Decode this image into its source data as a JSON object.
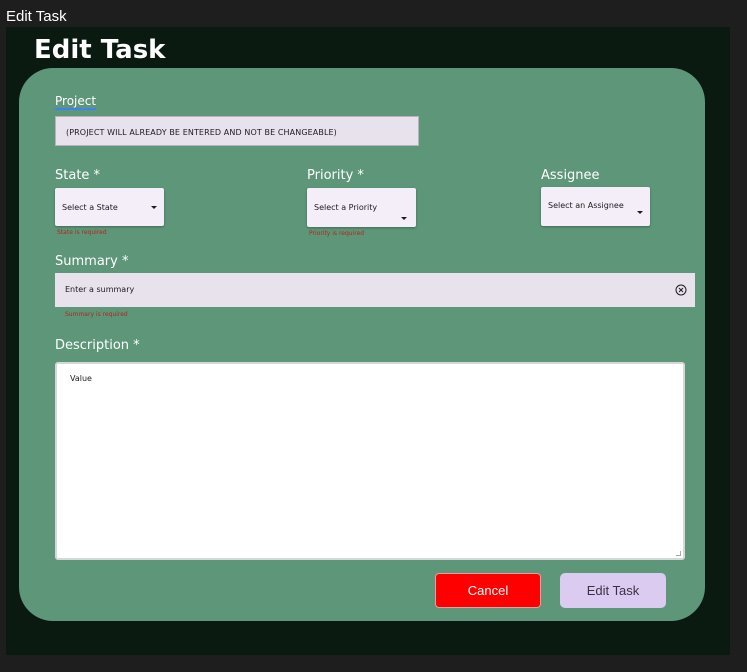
{
  "frame_label": "Edit Task",
  "page": {
    "title": "Edit Task"
  },
  "project": {
    "label": "Project",
    "value": "(PROJECT WILL ALREADY BE ENTERED AND NOT BE CHANGEABLE)"
  },
  "state": {
    "label": "State *",
    "placeholder": "Select a State",
    "error": "State is required"
  },
  "priority": {
    "label": "Priority *",
    "placeholder": "Select a Priority",
    "error": "Priority is required"
  },
  "assignee": {
    "label": "Assignee",
    "placeholder": "Select an Assignee"
  },
  "summary": {
    "label": "Summary *",
    "placeholder": "Enter a summary",
    "error": "Summary is required"
  },
  "description": {
    "label": "Description *",
    "value": "Value"
  },
  "buttons": {
    "cancel": "Cancel",
    "submit": "Edit Task"
  },
  "colors": {
    "background": "#1e1e1e",
    "frame": "#0b1a11",
    "card": "#5d9679",
    "cancel": "#ff0000",
    "submit": "#dccbf0",
    "error": "#b3261e"
  },
  "icons": {
    "caret": "caret-down-icon",
    "clear": "clear-circle-icon"
  }
}
